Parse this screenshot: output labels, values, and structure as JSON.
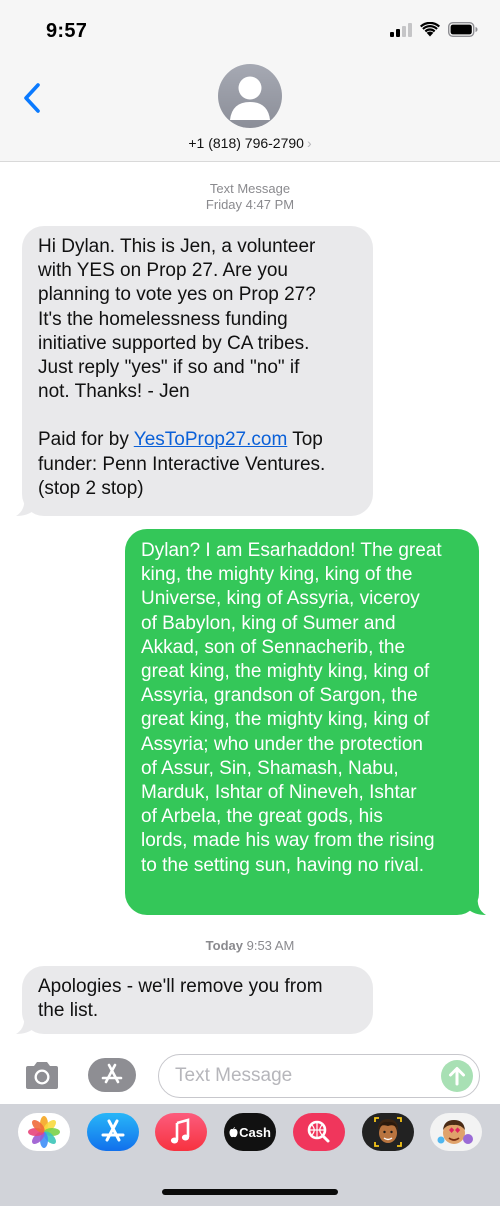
{
  "status_bar": {
    "time": "9:57"
  },
  "header": {
    "phone_number": "+1 (818) 796-2790",
    "chevron": "›"
  },
  "conversation": {
    "group1_label": "Text Message",
    "group1_time": "Friday 4:47 PM",
    "msg1_text": "Hi Dylan. This is Jen, a volunteer\nwith YES on Prop 27. Are you\nplanning to vote yes on Prop 27?\nIt's the homelessness funding\ninitiative supported by CA tribes.\nJust reply \"yes\" if so and \"no\" if\nnot. Thanks! - Jen",
    "msg1_paid_prefix": "Paid for by ",
    "msg1_link": "YesToProp27.com",
    "msg1_paid_suffix": " Top\nfunder: Penn Interactive Ventures.\n(stop 2 stop)",
    "msg2_text": "Dylan? I am Esarhaddon! The great\nking, the mighty king, king of the\nUniverse, king of Assyria, viceroy\nof Babylon, king of Sumer and\nAkkad, son of Sennacherib, the\ngreat king, the mighty king, king of\nAssyria, grandson of Sargon, the\ngreat king, the mighty king, king of\nAssyria; who under the protection\nof Assur, Sin, Shamash, Nabu,\nMarduk, Ishtar of Nineveh, Ishtar\nof Arbela, the great gods, his\nlords, made his way from the rising\nto the setting sun, having no rival.",
    "group2_day": "Today",
    "group2_time": " 9:53 AM",
    "msg3_text": "Apologies - we'll remove you from\nthe list."
  },
  "compose": {
    "placeholder": "Text Message"
  },
  "apps": {
    "cash_label": "Cash",
    "icons": [
      "photos-icon",
      "app-store-icon",
      "music-icon",
      "apple-cash-icon",
      "search-images-icon",
      "memoji-icon",
      "memoji-stickers-icon"
    ]
  },
  "colors": {
    "outgoing": "#34c759",
    "incoming": "#e9e9eb",
    "accent": "#0a7aff"
  }
}
